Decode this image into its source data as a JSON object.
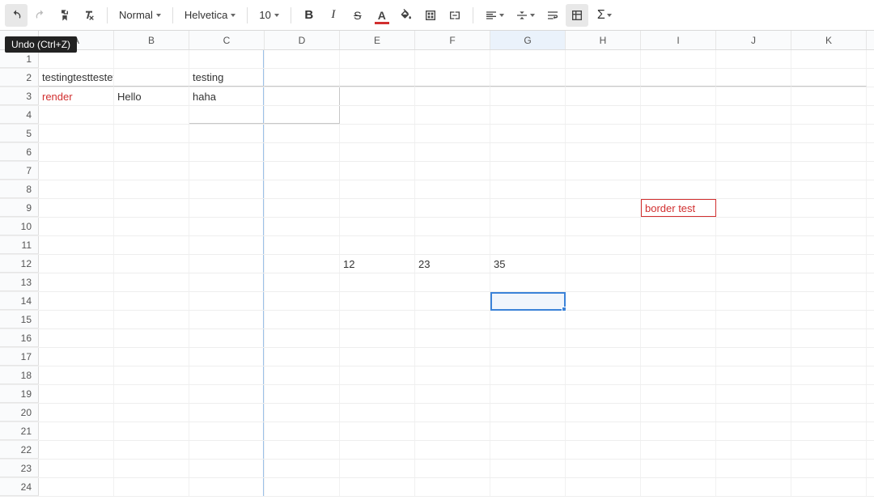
{
  "toolbar": {
    "undo_tooltip": "Undo (Ctrl+Z)",
    "format_dropdown": "Normal",
    "font_dropdown": "Helvetica",
    "size_dropdown": "10"
  },
  "columns": [
    {
      "key": "A",
      "width": 93
    },
    {
      "key": "B",
      "width": 93
    },
    {
      "key": "C",
      "width": 93
    },
    {
      "key": "D",
      "width": 93
    },
    {
      "key": "E",
      "width": 93
    },
    {
      "key": "F",
      "width": 93
    },
    {
      "key": "G",
      "width": 93
    },
    {
      "key": "H",
      "width": 93
    },
    {
      "key": "I",
      "width": 93
    },
    {
      "key": "J",
      "width": 93
    },
    {
      "key": "K",
      "width": 93
    }
  ],
  "rows_count": 24,
  "selected": {
    "col": "G",
    "row": 14
  },
  "selected_column": "G",
  "cells": {
    "A2": {
      "text": "testingtesttestets"
    },
    "C2": {
      "text": "testing"
    },
    "A3": {
      "text": "render",
      "red": true
    },
    "B3": {
      "text": "Hello"
    },
    "C3": {
      "text": "haha",
      "tall": true
    },
    "I9": {
      "text": "border test",
      "redborder": true
    },
    "E12": {
      "text": "12"
    },
    "F12": {
      "text": "23"
    },
    "G12": {
      "text": "35"
    }
  }
}
